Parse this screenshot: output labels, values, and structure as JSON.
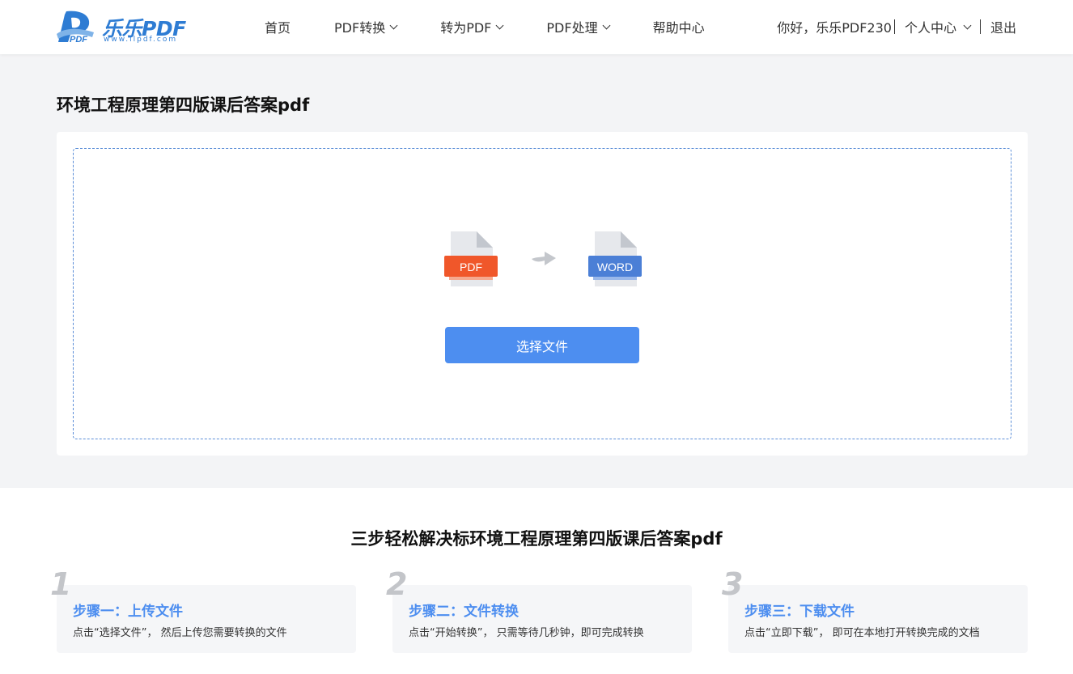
{
  "header": {
    "logo_text": "乐乐PDF",
    "logo_sub": "www.llpdf.com",
    "nav": [
      {
        "label": "首页",
        "has_dropdown": false
      },
      {
        "label": "PDF转换",
        "has_dropdown": true
      },
      {
        "label": "转为PDF",
        "has_dropdown": true
      },
      {
        "label": "PDF处理",
        "has_dropdown": true
      },
      {
        "label": "帮助中心",
        "has_dropdown": false
      }
    ],
    "greeting": "你好，乐乐PDF230",
    "user_center": "个人中心",
    "logout": "退出"
  },
  "page": {
    "title": "环境工程原理第四版课后答案pdf"
  },
  "converter": {
    "from_label": "PDF",
    "to_label": "WORD",
    "select_button": "选择文件",
    "colors": {
      "pdf": "#f0572a",
      "word": "#4b7fd6",
      "button": "#4d8ef0"
    }
  },
  "steps": {
    "title": "三步轻松解决标环境工程原理第四版课后答案pdf",
    "items": [
      {
        "num": "1",
        "head": "步骤一：上传文件",
        "desc": "点击“选择文件”， 然后上传您需要转换的文件"
      },
      {
        "num": "2",
        "head": "步骤二：文件转换",
        "desc": "点击“开始转换”， 只需等待几秒钟，即可完成转换"
      },
      {
        "num": "3",
        "head": "步骤三：下载文件",
        "desc": "点击“立即下载”， 即可在本地打开转换完成的文档"
      }
    ]
  }
}
